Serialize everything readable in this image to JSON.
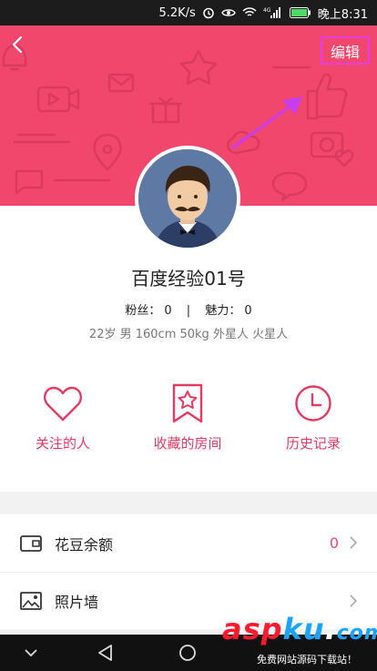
{
  "status_bar": {
    "speed": "5.2K/s",
    "battery": "",
    "time": "晚上8:31",
    "network": "4G"
  },
  "header": {
    "edit_label": "编辑"
  },
  "profile": {
    "name": "百度经验01号",
    "fans_label": "粉丝：",
    "fans_value": "0",
    "separator": "|",
    "charm_label": "魅力：",
    "charm_value": "0",
    "bio": "22岁 男 160cm 50kg 外星人 火星人"
  },
  "actions": [
    {
      "label": "关注的人",
      "icon": "heart-icon"
    },
    {
      "label": "收藏的房间",
      "icon": "bookmark-star-icon"
    },
    {
      "label": "历史记录",
      "icon": "clock-icon"
    }
  ],
  "list": [
    {
      "label": "花豆余额",
      "value": "0",
      "icon": "wallet-icon"
    },
    {
      "label": "照片墙",
      "value": "",
      "icon": "image-icon"
    }
  ],
  "watermark": {
    "brand_a": "asp",
    "brand_b": "ku",
    "brand_tld": "com",
    "subtitle": "免费网站源码下载站！"
  },
  "colors": {
    "accent": "#f2476c",
    "highlight": "#e43ce8"
  }
}
